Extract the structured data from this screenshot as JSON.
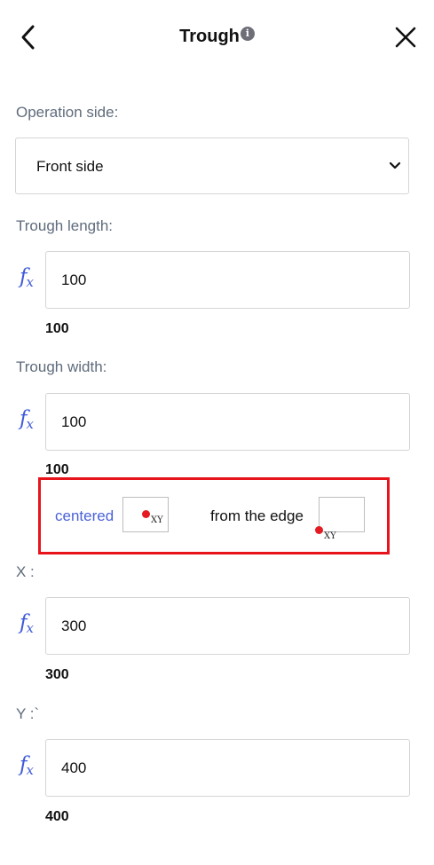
{
  "header": {
    "title": "Trough",
    "info_icon_glyph": "i",
    "back_icon": "chevron-left-icon",
    "close_icon": "close-icon"
  },
  "operation_side": {
    "label": "Operation side:",
    "selected": "Front side"
  },
  "trough_length": {
    "label": "Trough length:",
    "formula": "100",
    "result": "100"
  },
  "trough_width": {
    "label": "Trough width:",
    "formula": "100",
    "result": "100"
  },
  "positioning": {
    "centered_label": "centered",
    "edge_label": "from the edge",
    "xy_label": "XY",
    "highlight_color": "#e8141c",
    "dot_color": "#e41b23"
  },
  "x": {
    "label": "X :",
    "formula": "300",
    "result": "300"
  },
  "y": {
    "label": "Y :`",
    "formula": "400",
    "result": "400"
  },
  "fx_icon": {
    "glyph_f": "f",
    "glyph_x": "x",
    "color": "#3f5bd8"
  },
  "accent_color": "#4a62d8"
}
